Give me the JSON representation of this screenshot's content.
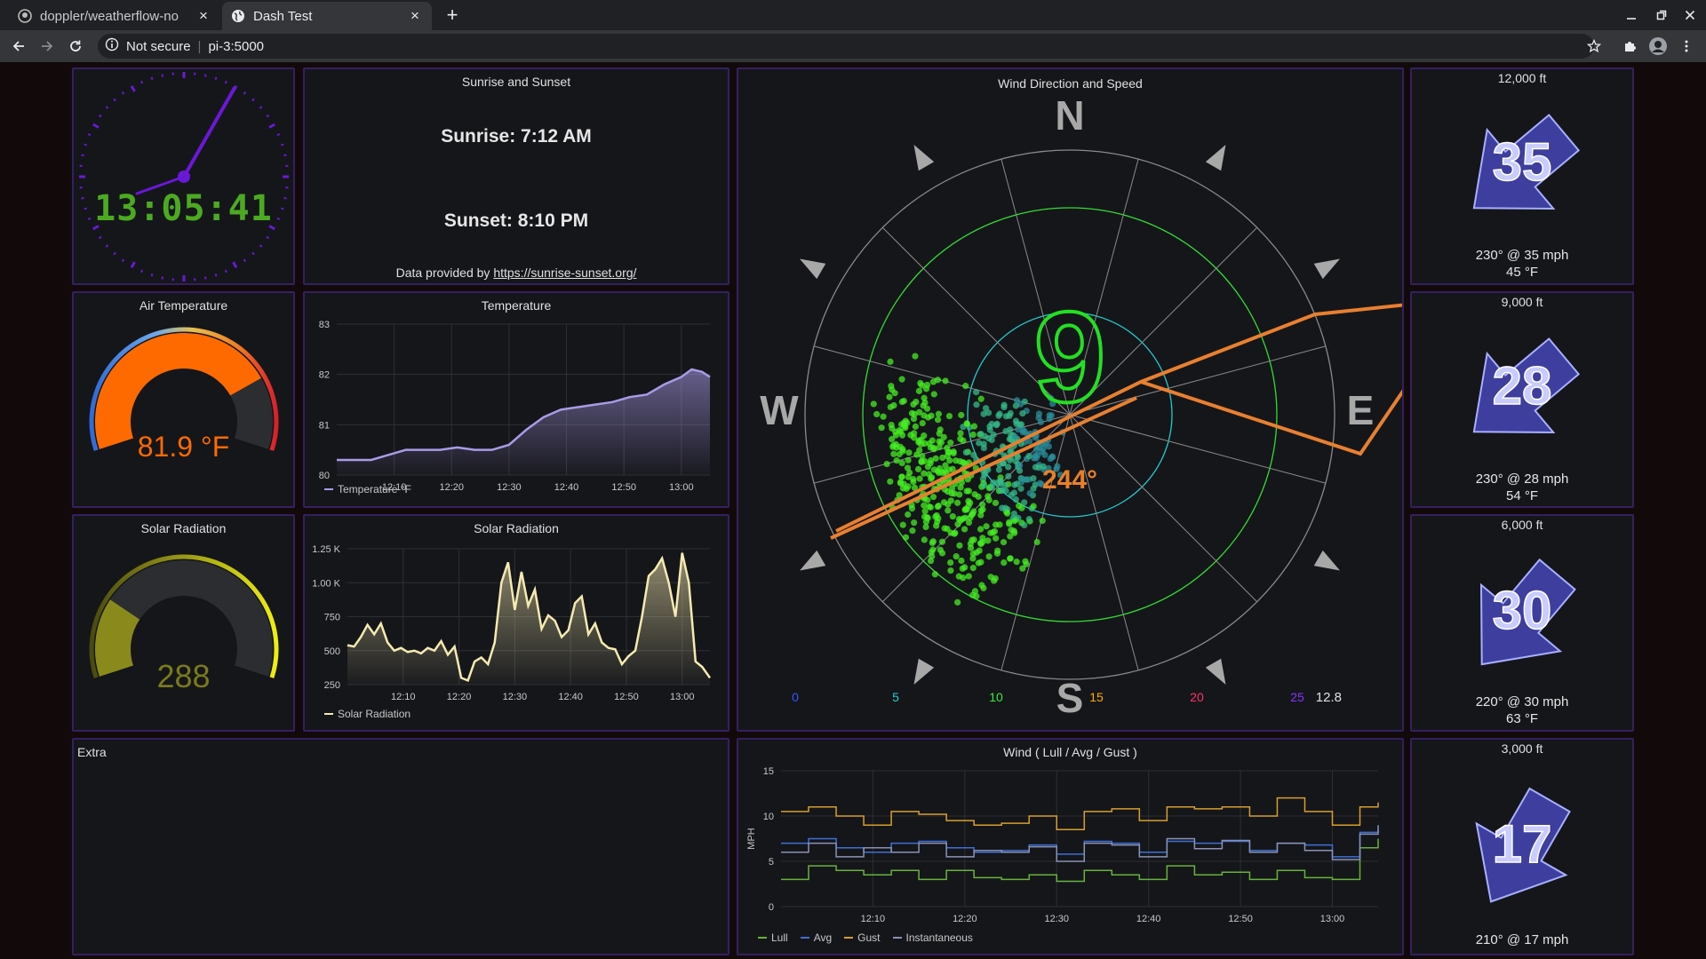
{
  "browser": {
    "tabs": [
      {
        "title": "doppler/weatherflow-no",
        "close": "×"
      },
      {
        "title": "Dash Test",
        "close": "×"
      }
    ],
    "new_tab": "+",
    "security": "Not secure",
    "url": "pi-3:5000"
  },
  "clock": {
    "time": "13:05:41"
  },
  "sun": {
    "title": "Sunrise and Sunset",
    "sunrise": "Sunrise: 7:12 AM",
    "sunset": "Sunset: 8:10 PM",
    "credit_prefix": "Data provided by ",
    "credit_link": "https://sunrise-sunset.org/"
  },
  "air_temp": {
    "title": "Air Temperature",
    "value": "81.9 °F",
    "fraction": 0.78
  },
  "solar_gauge": {
    "title": "Solar Radiation",
    "value": "288",
    "fraction": 0.24
  },
  "extra": {
    "title": "Extra"
  },
  "wind_rose": {
    "title": "Wind Direction and Speed",
    "speed": "9",
    "direction": "244°",
    "cardinals": {
      "n": "N",
      "e": "E",
      "s": "S",
      "w": "W"
    },
    "scale_labels": [
      "0",
      "5",
      "10",
      "15",
      "20",
      "25"
    ],
    "scale_colors": [
      "#3355ff",
      "#22cccc",
      "#33ee33",
      "#ffaa00",
      "#ff3366",
      "#8833ff"
    ],
    "scale_value": "12.8"
  },
  "aloft": [
    {
      "alt": "12,000 ft",
      "speed": "35",
      "line1": "230° @ 35 mph",
      "line2": "45 °F"
    },
    {
      "alt": "9,000 ft",
      "speed": "28",
      "line1": "230° @ 28 mph",
      "line2": "54 °F"
    },
    {
      "alt": "6,000 ft",
      "speed": "30",
      "line1": "220° @ 30 mph",
      "line2": "63 °F"
    },
    {
      "alt": "3,000 ft",
      "speed": "17",
      "line1": "210° @ 17 mph",
      "line2": ""
    }
  ],
  "chart_data": [
    {
      "type": "area",
      "title": "Temperature",
      "x_ticks": [
        "12:10",
        "12:20",
        "12:30",
        "12:40",
        "12:50",
        "13:00"
      ],
      "y_ticks": [
        "80",
        "81",
        "82",
        "83"
      ],
      "ylim": [
        80,
        83
      ],
      "xlim": [
        12.0,
        13.083
      ],
      "series": [
        {
          "name": "Temperature °F",
          "color": "#a99be6",
          "x": [
            12.0,
            12.05,
            12.1,
            12.15,
            12.2,
            12.25,
            12.3,
            12.35,
            12.4,
            12.45,
            12.5,
            12.55,
            12.6,
            12.65,
            12.7,
            12.75,
            12.8,
            12.85,
            12.9,
            12.95,
            13.0,
            13.03,
            13.06,
            13.083
          ],
          "y": [
            80.3,
            80.3,
            80.3,
            80.4,
            80.5,
            80.5,
            80.5,
            80.55,
            80.5,
            80.5,
            80.6,
            80.9,
            81.15,
            81.3,
            81.35,
            81.4,
            81.45,
            81.55,
            81.6,
            81.8,
            81.95,
            82.1,
            82.05,
            81.95
          ]
        }
      ]
    },
    {
      "type": "area",
      "title": "Solar Radiation",
      "x_ticks": [
        "12:10",
        "12:20",
        "12:30",
        "12:40",
        "12:50",
        "13:00"
      ],
      "y_ticks": [
        "250",
        "500",
        "750",
        "1.00 K",
        "1.25 K"
      ],
      "ylim": [
        250,
        1250
      ],
      "xlim": [
        12.0,
        13.083
      ],
      "series": [
        {
          "name": "Solar Radiation",
          "color": "#f5eab0",
          "x": [
            12.0,
            12.02,
            12.04,
            12.06,
            12.08,
            12.1,
            12.12,
            12.14,
            12.16,
            12.18,
            12.2,
            12.22,
            12.24,
            12.26,
            12.28,
            12.3,
            12.32,
            12.34,
            12.36,
            12.38,
            12.4,
            12.42,
            12.44,
            12.46,
            12.48,
            12.5,
            12.52,
            12.54,
            12.56,
            12.58,
            12.6,
            12.62,
            12.64,
            12.66,
            12.68,
            12.7,
            12.72,
            12.74,
            12.76,
            12.78,
            12.8,
            12.82,
            12.84,
            12.86,
            12.88,
            12.9,
            12.92,
            12.94,
            12.96,
            12.98,
            13.0,
            13.02,
            13.04,
            13.06,
            13.083
          ],
          "y": [
            540,
            530,
            600,
            690,
            620,
            700,
            560,
            500,
            520,
            490,
            500,
            480,
            520,
            500,
            570,
            470,
            530,
            300,
            280,
            420,
            450,
            400,
            560,
            1000,
            1150,
            800,
            1080,
            830,
            950,
            660,
            760,
            720,
            600,
            650,
            850,
            900,
            620,
            700,
            560,
            520,
            510,
            400,
            460,
            500,
            750,
            1050,
            1100,
            1180,
            1000,
            750,
            1220,
            1000,
            420,
            380,
            300
          ]
        }
      ]
    },
    {
      "type": "line",
      "title": "Wind ( Lull / Avg / Gust )",
      "ylabel": "MPH",
      "x_ticks": [
        "12:10",
        "12:20",
        "12:30",
        "12:40",
        "12:50",
        "13:00"
      ],
      "y_ticks": [
        "0",
        "5",
        "10",
        "15"
      ],
      "ylim": [
        0,
        15
      ],
      "xlim": [
        12.0,
        13.083
      ],
      "series": [
        {
          "name": "Lull",
          "color": "#66b33a",
          "x": [
            12.0,
            12.05,
            12.1,
            12.15,
            12.2,
            12.25,
            12.3,
            12.35,
            12.4,
            12.45,
            12.5,
            12.55,
            12.6,
            12.65,
            12.7,
            12.75,
            12.8,
            12.85,
            12.9,
            12.95,
            13.0,
            13.05,
            13.083
          ],
          "y": [
            3,
            4.5,
            4,
            3.5,
            4,
            3,
            4,
            3.2,
            3,
            3.5,
            2.8,
            4,
            3.5,
            3,
            4.5,
            3.5,
            3.8,
            3,
            4,
            3.2,
            3,
            6.5,
            7.5
          ]
        },
        {
          "name": "Avg",
          "color": "#3d6fd6",
          "x": [
            12.0,
            12.05,
            12.1,
            12.15,
            12.2,
            12.25,
            12.3,
            12.35,
            12.4,
            12.45,
            12.5,
            12.55,
            12.6,
            12.65,
            12.7,
            12.75,
            12.8,
            12.85,
            12.9,
            12.95,
            13.0,
            13.05,
            13.083
          ],
          "y": [
            7,
            7.5,
            6.5,
            6,
            7,
            7.2,
            6.5,
            6,
            6.2,
            6.8,
            5.8,
            7.2,
            7,
            6,
            7.2,
            7,
            7.2,
            6.2,
            7,
            6.8,
            5.5,
            8.2,
            8.5
          ]
        },
        {
          "name": "Gust",
          "color": "#d69e2e",
          "x": [
            12.0,
            12.05,
            12.1,
            12.15,
            12.2,
            12.25,
            12.3,
            12.35,
            12.4,
            12.45,
            12.5,
            12.55,
            12.6,
            12.65,
            12.7,
            12.75,
            12.8,
            12.85,
            12.9,
            12.95,
            13.0,
            13.05,
            13.083
          ],
          "y": [
            10.5,
            11,
            10,
            9,
            10.5,
            10.2,
            9.5,
            9,
            9.2,
            10,
            8.5,
            10.5,
            10.8,
            9.5,
            11,
            10.8,
            11,
            10,
            12,
            10.5,
            9,
            11,
            11.5
          ]
        },
        {
          "name": "Instantaneous",
          "color": "#8a92b4",
          "x": [
            12.0,
            12.05,
            12.1,
            12.15,
            12.2,
            12.25,
            12.3,
            12.35,
            12.4,
            12.45,
            12.5,
            12.55,
            12.6,
            12.65,
            12.7,
            12.75,
            12.8,
            12.85,
            12.9,
            12.95,
            13.0,
            13.05,
            13.083
          ],
          "y": [
            6,
            7,
            5.5,
            6.5,
            6,
            7,
            5.5,
            6.2,
            6,
            6.6,
            5,
            7,
            6.8,
            5.5,
            7.5,
            6.4,
            7.3,
            6,
            7,
            6.2,
            5.2,
            8,
            9
          ]
        }
      ]
    }
  ]
}
